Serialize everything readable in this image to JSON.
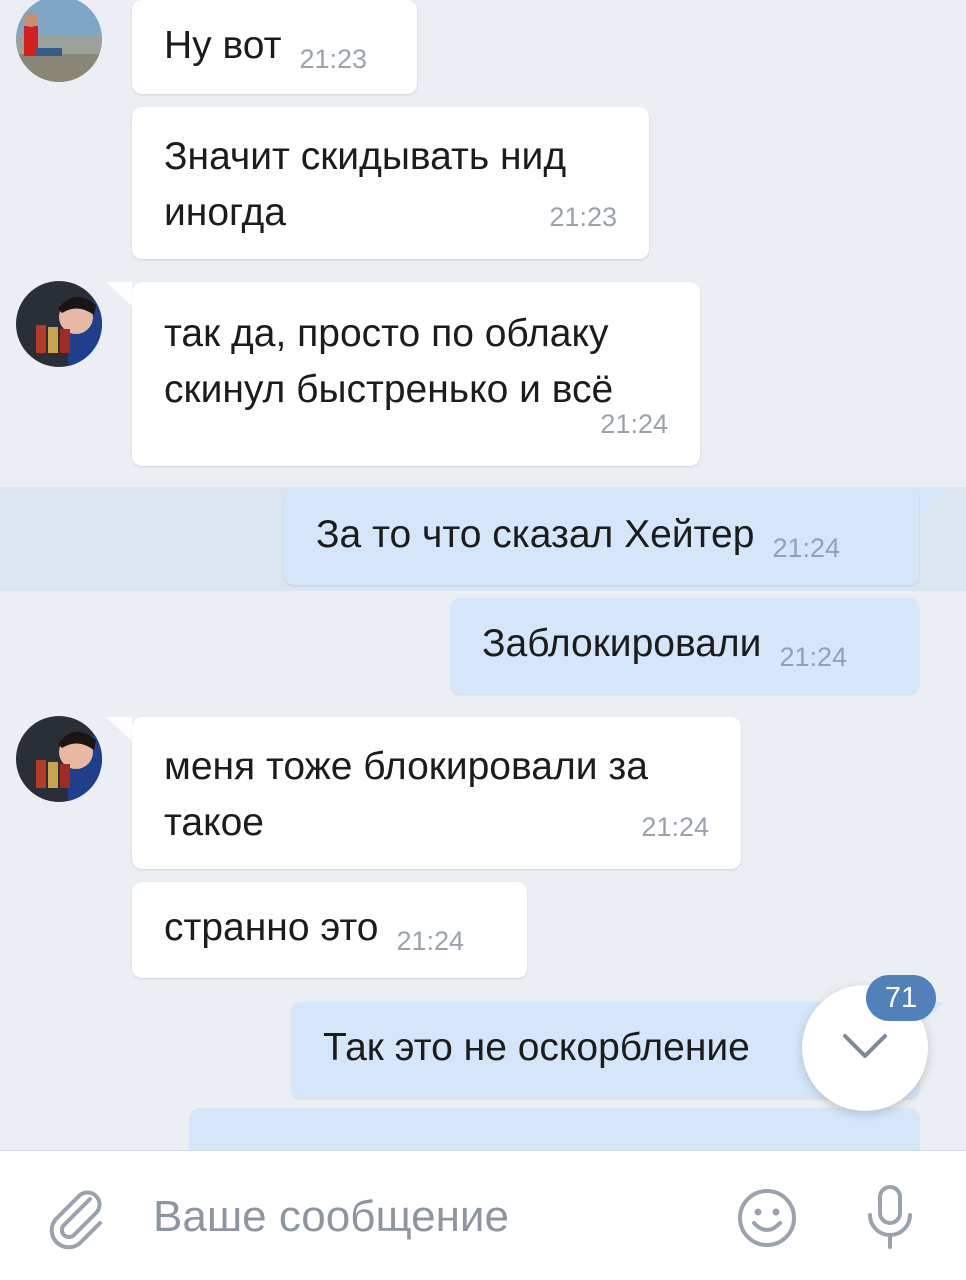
{
  "messages": [
    {
      "text": "Ну вот",
      "time": "21:23",
      "dir": "in"
    },
    {
      "text": "Значит скидывать нид\nиногда",
      "time": "21:23",
      "dir": "in"
    },
    {
      "text": "так да, просто по облаку\nскинул быстренько и всё",
      "time": "21:24",
      "dir": "in"
    },
    {
      "text": "За то что сказал Хейтер",
      "time": "21:24",
      "dir": "out"
    },
    {
      "text": "Заблокировали",
      "time": "21:24",
      "dir": "out"
    },
    {
      "text": "меня тоже блокировали за\nтакое",
      "time": "21:24",
      "dir": "in"
    },
    {
      "text": "странно это",
      "time": "21:24",
      "dir": "in"
    },
    {
      "text": "Так это не оскорбление",
      "time": "",
      "dir": "out"
    }
  ],
  "scroll_down": {
    "unread_count": "71",
    "icon": "chevron-down-icon"
  },
  "composer": {
    "placeholder": "Ваше сообщение",
    "attach_icon": "paperclip-icon",
    "emoji_icon": "smile-icon",
    "mic_icon": "microphone-icon"
  },
  "colors": {
    "background": "#ebeef3",
    "incoming": "#ffffff",
    "outgoing": "#d6e6fa",
    "accent": "#5181b8",
    "highlight": "#dbe5ef"
  }
}
